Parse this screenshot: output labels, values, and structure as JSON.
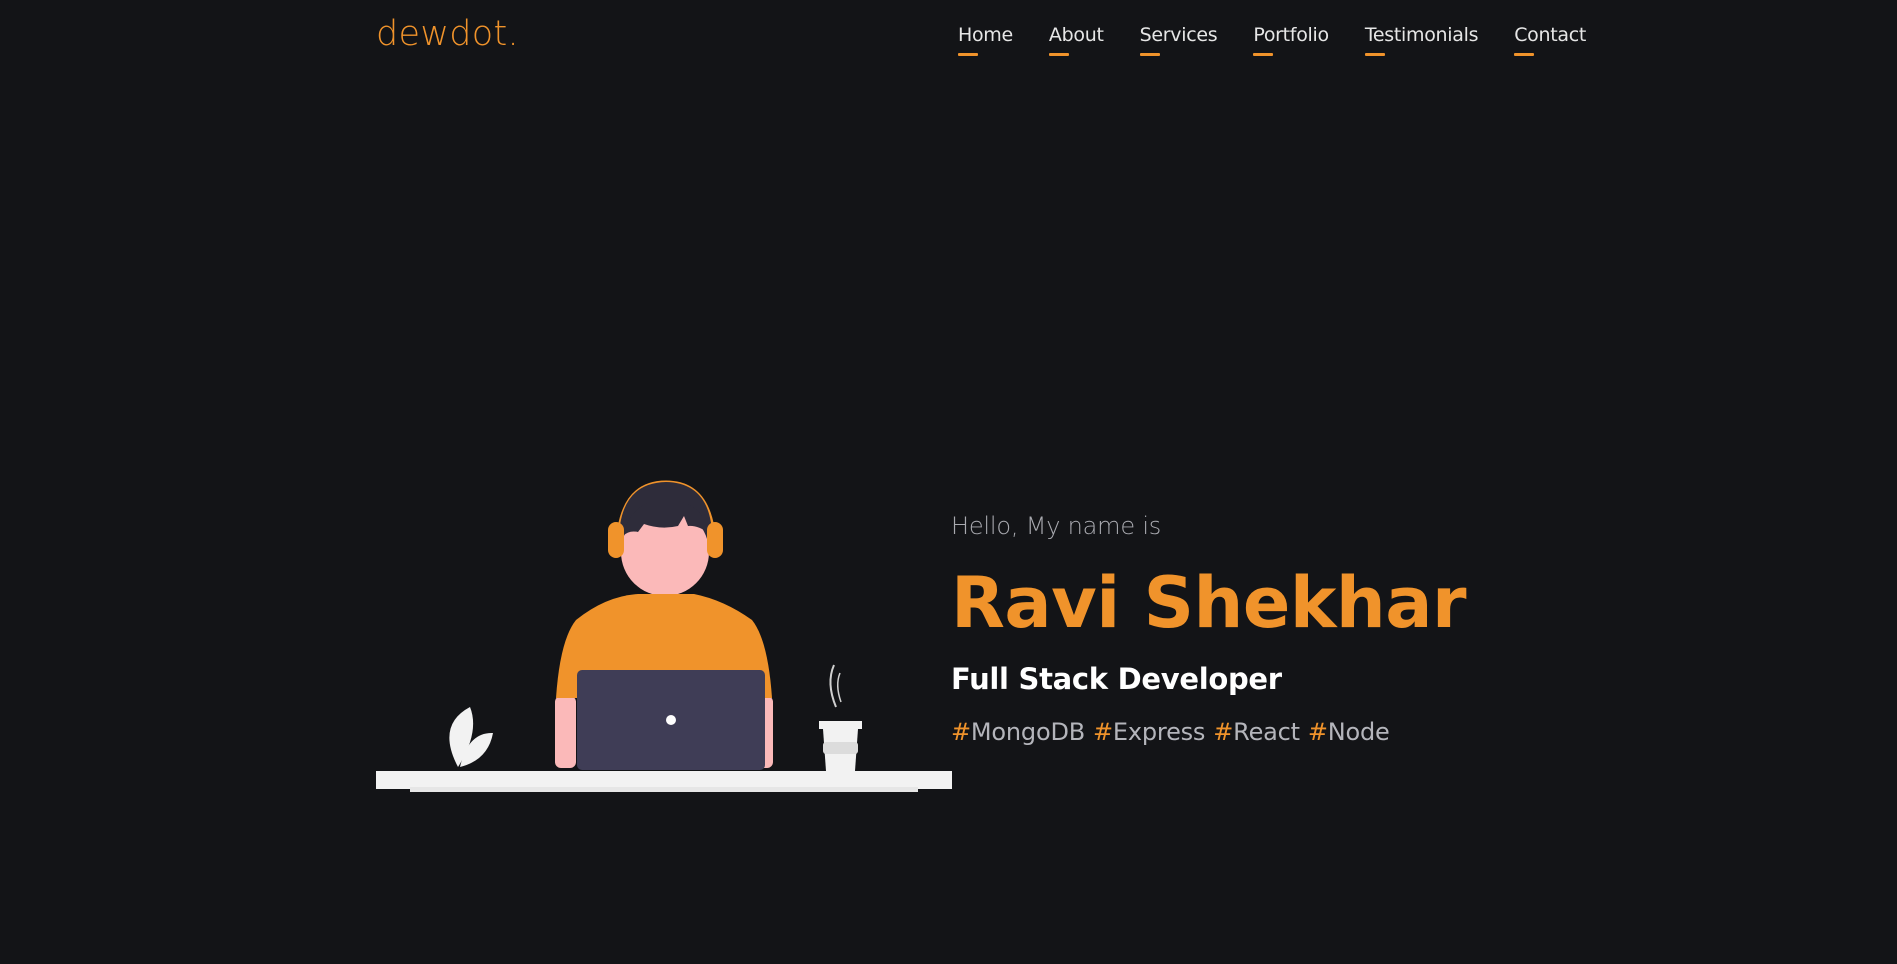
{
  "brand": {
    "logo_text": "dewdot",
    "logo_dot": "."
  },
  "nav": {
    "items": [
      {
        "label": "Home"
      },
      {
        "label": "About"
      },
      {
        "label": "Services"
      },
      {
        "label": "Portfolio"
      },
      {
        "label": "Testimonials"
      },
      {
        "label": "Contact"
      }
    ]
  },
  "hero": {
    "greeting": "Hello, My name is",
    "name": "Ravi Shekhar",
    "role": "Full Stack Developer",
    "tags": [
      {
        "hash": "#",
        "label": "MongoDB"
      },
      {
        "hash": "#",
        "label": "Express"
      },
      {
        "hash": "#",
        "label": "React"
      },
      {
        "hash": "#",
        "label": "Node"
      }
    ]
  },
  "colors": {
    "background": "#131417",
    "accent": "#f0932b",
    "text_primary": "#ffffff",
    "text_muted": "#a9aab0"
  },
  "icons": {
    "illustration": "developer-at-desk-illustration"
  }
}
